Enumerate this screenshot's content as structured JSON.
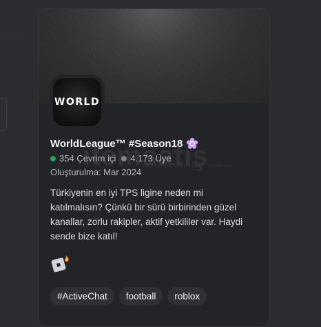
{
  "server": {
    "icon_text": "WORLD",
    "name": "WorldLeague™ #Season18",
    "online": "354 Çevrim içi",
    "members": "4.173 Üye",
    "established": "Oluşturulma: Mar 2024",
    "description": "Türkiyenin en iyi TPS ligine neden mi katılmalısın? Çünkü bir sürü birbirinden güzel kanallar, zorlu rakipler, aktif yetkililer var. Haydi sende bize katıl!",
    "tags": [
      "#ActiveChat",
      "football",
      "roblox"
    ]
  },
  "watermark": {
    "main": "itemsatış",
    "sub": "Dijital Ürün Alım Satım Platformu · itemsatis.com"
  },
  "colors": {
    "online_dot": "#23a55a",
    "members_dot": "#80848e",
    "boost_badge": "#c8a2f0"
  },
  "icons": {
    "badge": "flower-badge-icon",
    "game": "roblox-game-icon"
  }
}
